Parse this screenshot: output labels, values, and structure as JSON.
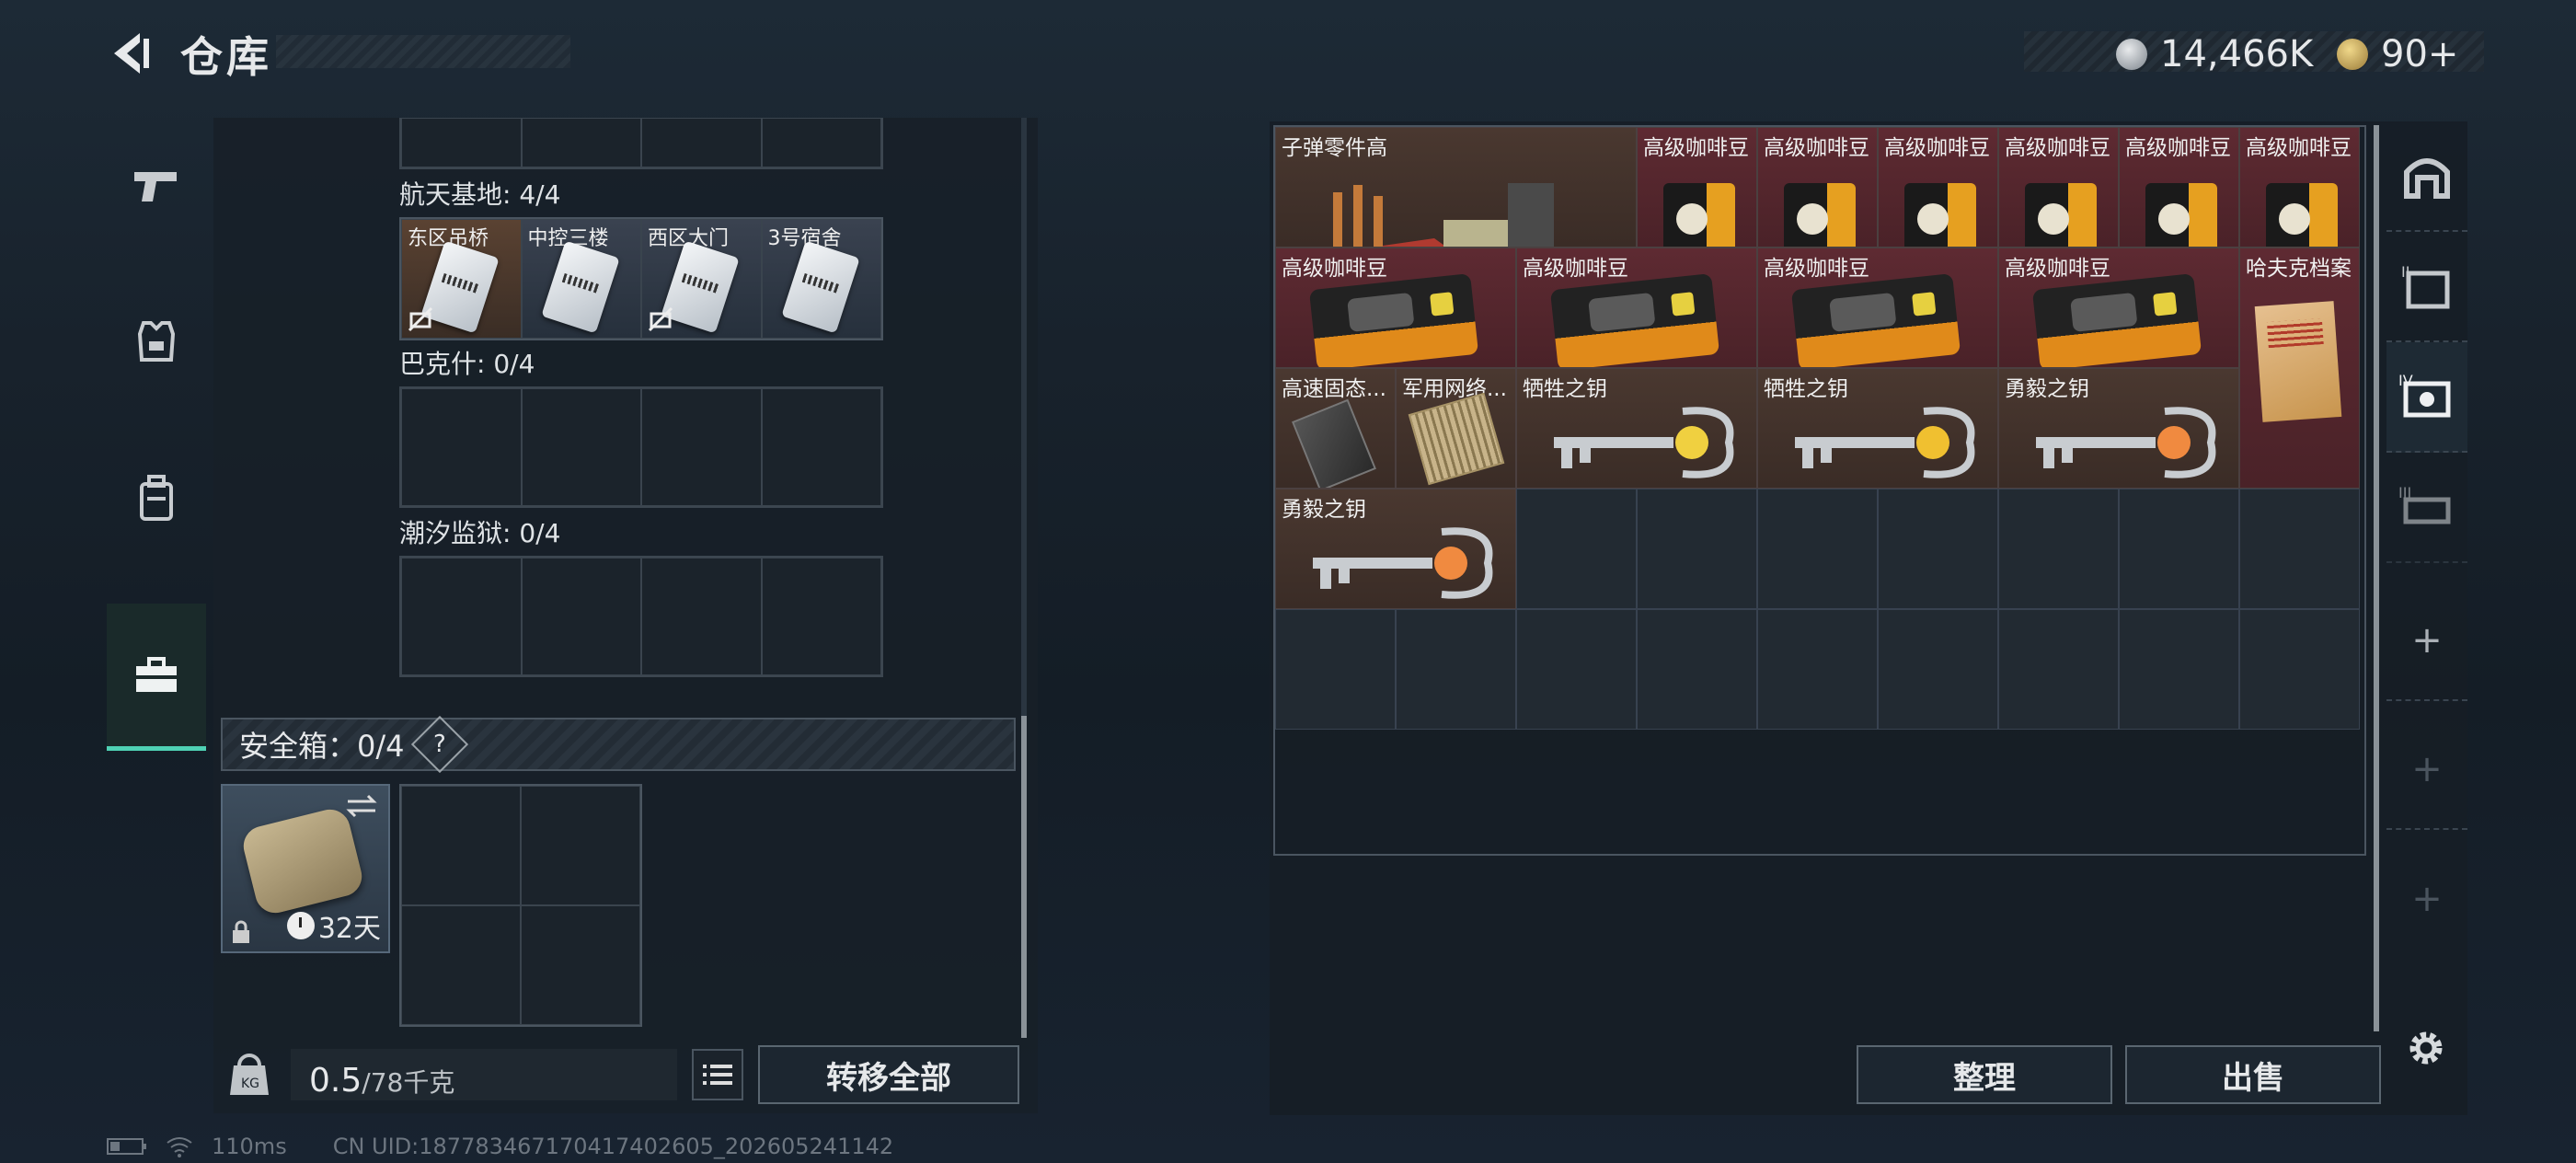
{
  "header": {
    "title": "仓库",
    "currency_1": "14,466K",
    "currency_2": "90+"
  },
  "left_nav": {
    "items": [
      "weapons",
      "armor",
      "backpack",
      "items"
    ],
    "active": "items"
  },
  "key_groups": [
    {
      "label": "航天基地: 4/4",
      "cells": [
        {
          "name": "东区吊桥",
          "no_entry": true,
          "warm": true
        },
        {
          "name": "中控三楼",
          "no_entry": false,
          "warm": false
        },
        {
          "name": "西区大门",
          "no_entry": true,
          "warm": false
        },
        {
          "name": "3号宿舍",
          "no_entry": false,
          "warm": false
        }
      ]
    },
    {
      "label": "巴克什: 0/4",
      "cells": []
    },
    {
      "label": "潮汐监狱: 0/4",
      "cells": []
    }
  ],
  "safe_box": {
    "label": "安全箱：0/4",
    "help": "?",
    "days": "32天"
  },
  "bottom": {
    "weight_current": "0.5",
    "weight_max": "/78千克",
    "move_all": "转移全部"
  },
  "status": {
    "ping": "110ms",
    "uid": "CN UID:18778346717041740​2605_202605241142"
  },
  "stash_items": [
    {
      "name": "子弹零件高",
      "type": "ammo",
      "style": "brown"
    },
    {
      "name": "高级咖啡豆",
      "type": "bag",
      "style": "red"
    },
    {
      "name": "高级咖啡豆",
      "type": "bag",
      "style": "red"
    },
    {
      "name": "高级咖啡豆",
      "type": "bag",
      "style": "red"
    },
    {
      "name": "高级咖啡豆",
      "type": "bag",
      "style": "red"
    },
    {
      "name": "高级咖啡豆",
      "type": "bag",
      "style": "red"
    },
    {
      "name": "高级咖啡豆",
      "type": "bag",
      "style": "red"
    },
    {
      "name": "高级咖啡豆",
      "type": "tin",
      "style": "red"
    },
    {
      "name": "高级咖啡豆",
      "type": "tin",
      "style": "red"
    },
    {
      "name": "高级咖啡豆",
      "type": "tin",
      "style": "red"
    },
    {
      "name": "高级咖啡豆",
      "type": "tin",
      "style": "red"
    },
    {
      "name": "哈夫克档案",
      "type": "folder",
      "style": "red"
    },
    {
      "name": "高速固态...",
      "type": "drive",
      "style": "brown"
    },
    {
      "name": "军用网络...",
      "type": "net",
      "style": "brown"
    },
    {
      "name": "牺牲之钥",
      "type": "key",
      "style": "brown"
    },
    {
      "name": "牺牲之钥",
      "type": "key",
      "style": "brown"
    },
    {
      "name": "勇毅之钥",
      "type": "key",
      "style": "brown"
    },
    {
      "name": "勇毅之钥",
      "type": "key",
      "style": "brown"
    }
  ],
  "actions": {
    "sort": "整理",
    "sell": "出售"
  },
  "right_nav": {
    "items": [
      "tab-1",
      "tab-2",
      "tab-3",
      "tab-4"
    ],
    "active": "tab-3"
  },
  "colors": {
    "accent": "#4fd1b4",
    "red_slot": "#5e2a32",
    "brown_slot": "#4a3830"
  }
}
